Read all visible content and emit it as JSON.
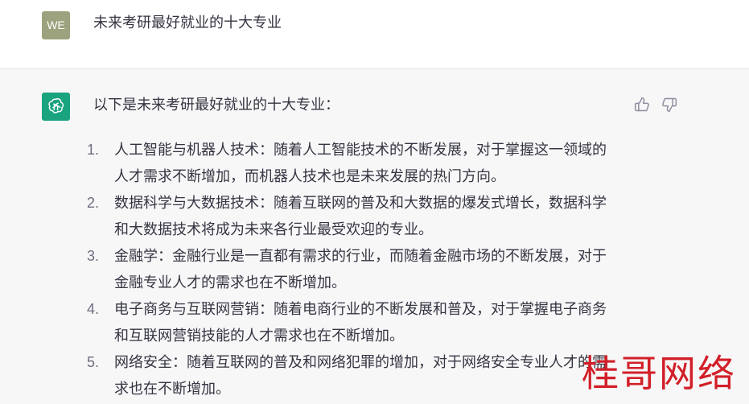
{
  "user_message": {
    "avatar_initials": "WE",
    "text": "未来考研最好就业的十大专业"
  },
  "assistant_message": {
    "avatar_icon": "openai-logo-icon",
    "intro": "以下是未来考研最好就业的十大专业：",
    "items": [
      {
        "number": "1.",
        "text": "人工智能与机器人技术：随着人工智能技术的不断发展，对于掌握这一领域的人才需求不断增加，而机器人技术也是未来发展的热门方向。"
      },
      {
        "number": "2.",
        "text": "数据科学与大数据技术：随着互联网的普及和大数据的爆发式增长，数据科学和大数据技术将成为未来各行业最受欢迎的专业。"
      },
      {
        "number": "3.",
        "text": "金融学：金融行业是一直都有需求的行业，而随着金融市场的不断发展，对于金融专业人才的需求也在不断增加。"
      },
      {
        "number": "4.",
        "text": "电子商务与互联网营销：随着电商行业的不断发展和普及，对于掌握电子商务和互联网营销技能的人才需求也在不断增加。"
      },
      {
        "number": "5.",
        "text": "网络安全：随着互联网的普及和网络犯罪的增加，对于网络安全专业人才的需求也在不断增加。"
      }
    ],
    "feedback": {
      "thumbs_up_icon": "thumbs-up-icon",
      "thumbs_down_icon": "thumbs-down-icon"
    }
  },
  "watermark": "桂哥网络",
  "colors": {
    "user_avatar_bg": "#9ba27d",
    "bot_avatar_bg": "#19a37f",
    "assistant_bg": "#f7f7f8",
    "text": "#343541",
    "watermark": "#d21f28"
  }
}
